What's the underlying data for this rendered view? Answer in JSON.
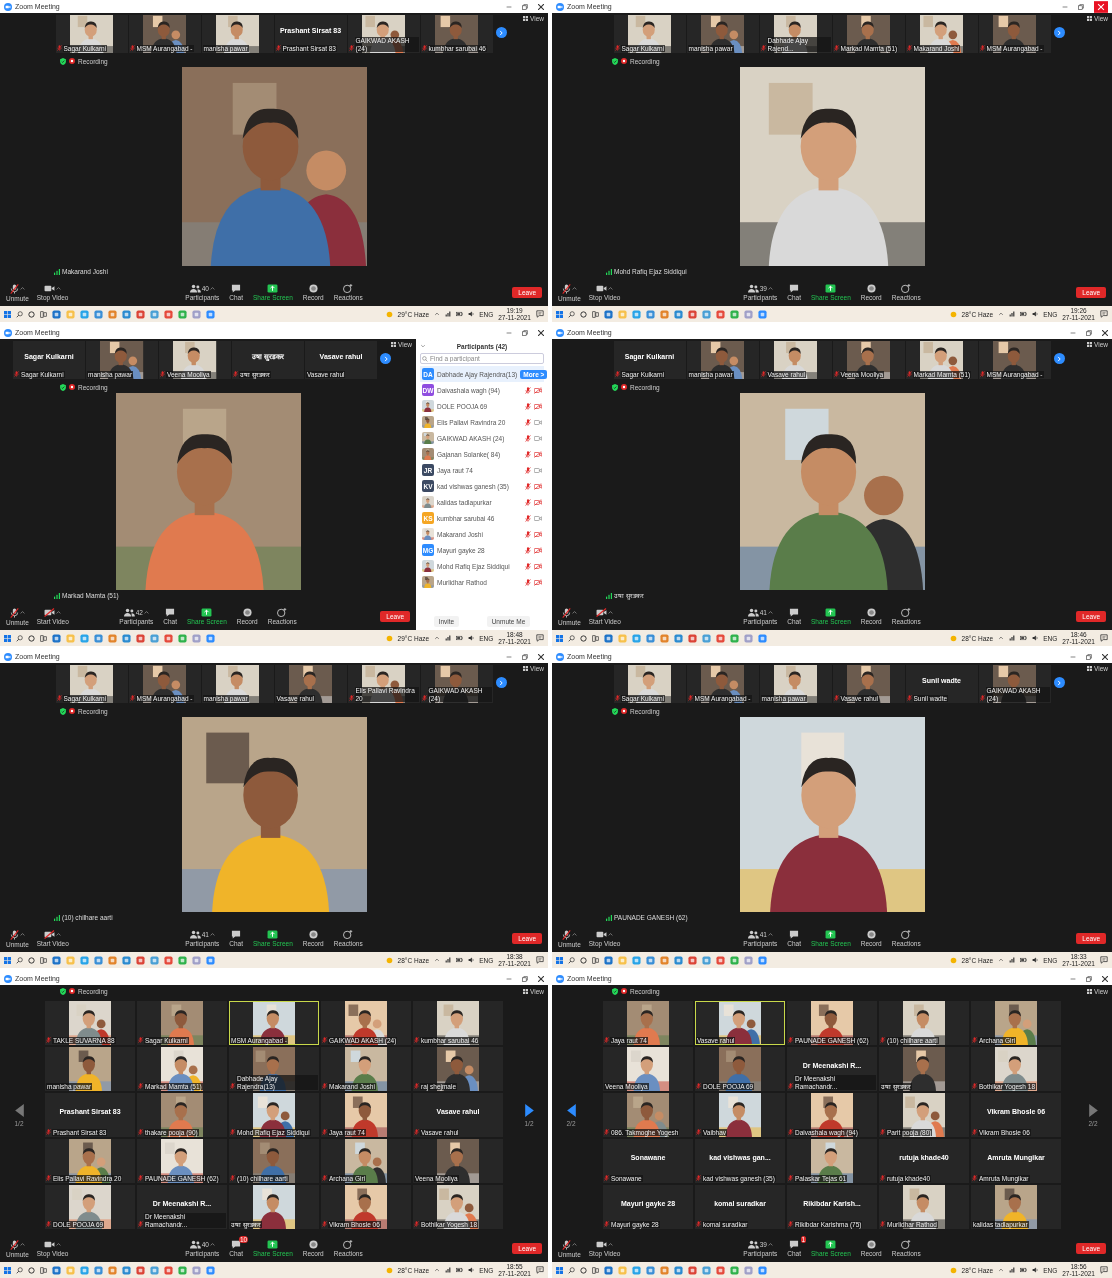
{
  "screens": [
    {
      "title": "Zoom Meeting",
      "close_highlighted": false,
      "view": "View",
      "recording": "Recording",
      "strip": [
        {
          "kind": "video",
          "name": "Sagar Kulkarni",
          "muted": true
        },
        {
          "kind": "video",
          "name": "MSM Aurangabad -",
          "muted": true
        },
        {
          "kind": "video",
          "name": "manisha pawar",
          "muted": false
        },
        {
          "kind": "name",
          "title": "Prashant Sirsat 83",
          "name": "Prashant Sirsat 83",
          "muted": true
        },
        {
          "kind": "video",
          "name": "GAIKWAD AKASH (24)",
          "muted": true
        },
        {
          "kind": "video",
          "name": "kumbhar sarubai 46",
          "muted": true
        }
      ],
      "speaker": {
        "name": "Makarand Joshi"
      },
      "toolbar": {
        "audio": "Unmute",
        "video": {
          "label": "Stop Video",
          "on": true
        },
        "participants": {
          "label": "Participants",
          "count": "40"
        },
        "chat": {
          "label": "Chat"
        },
        "share": "Share Screen",
        "record": "Record",
        "reactions": "Reactions",
        "leave": "Leave"
      },
      "taskbar": {
        "weather": "29°C Haze",
        "language": "ENG",
        "time": "19:19",
        "date": "27-11-2021"
      }
    },
    {
      "title": "Zoom Meeting",
      "close_highlighted": true,
      "view": "View",
      "recording": "Recording",
      "strip": [
        {
          "kind": "video",
          "name": "Sagar Kulkarni",
          "muted": true
        },
        {
          "kind": "video",
          "name": "manisha pawar",
          "muted": false
        },
        {
          "kind": "video",
          "name": "Dabhade Ajay Rajend...",
          "muted": true
        },
        {
          "kind": "video",
          "name": "Markad Mamta (51)",
          "muted": true
        },
        {
          "kind": "video",
          "name": "Makarand Joshi",
          "muted": true
        },
        {
          "kind": "video",
          "name": "MSM Aurangabad -",
          "muted": true
        }
      ],
      "speaker": {
        "name": "Mohd Rafiq Ejaz Siddiqui"
      },
      "toolbar": {
        "audio": "Unmute",
        "video": {
          "label": "Stop Video",
          "on": true
        },
        "participants": {
          "label": "Participants",
          "count": "39"
        },
        "chat": {
          "label": "Chat"
        },
        "share": "Share Screen",
        "record": "Record",
        "reactions": "Reactions",
        "leave": "Leave"
      },
      "taskbar": {
        "weather": "28°C Haze",
        "language": "ENG",
        "time": "19:26",
        "date": "27-11-2021"
      }
    },
    {
      "title": "Zoom Meeting",
      "close_highlighted": false,
      "view": "View",
      "recording": "Recording",
      "strip": [
        {
          "kind": "name",
          "title": "Sagar Kulkarni",
          "name": "Sagar Kulkarni",
          "muted": true
        },
        {
          "kind": "video",
          "name": "manisha pawar",
          "muted": false
        },
        {
          "kind": "video",
          "name": "Veena Mooliya",
          "muted": true
        },
        {
          "kind": "name",
          "title": "उषा सुरडकर",
          "name": "उषा सुरडकर",
          "muted": true
        },
        {
          "kind": "name",
          "title": "Vasave rahul",
          "name": "Vasave rahul",
          "muted": false
        }
      ],
      "speaker": {
        "name": "Markad Mamta (51)"
      },
      "participants_panel": {
        "title": "Participants (42)",
        "placeholder": "Find a participant",
        "items": [
          {
            "name": "Dabhade Ajay Rajendra(13)",
            "avatar": {
              "kind": "initials",
              "text": "DA",
              "color": "#2d8cff"
            },
            "selected": true,
            "action": "More >"
          },
          {
            "name": "Daivashala wagh (94)",
            "avatar": {
              "kind": "initials",
              "text": "DW",
              "color": "#8f4de0"
            },
            "selected": false,
            "muted": true,
            "video_on": false
          },
          {
            "name": "DOLE POOJA 69",
            "selected": false,
            "muted": true,
            "video_on": false
          },
          {
            "name": "Elis Pallavi Ravindra 20",
            "selected": false,
            "muted": true,
            "video_on": true
          },
          {
            "name": "GAIKWAD AKASH (24)",
            "selected": false,
            "muted": true,
            "video_on": true
          },
          {
            "name": "Gajanan Solanke( 84)",
            "selected": false,
            "muted": true,
            "video_on": false
          },
          {
            "name": "Jaya raut 74",
            "avatar": {
              "kind": "initials",
              "text": "JR",
              "color": "#3c4a63"
            },
            "selected": false,
            "muted": true,
            "video_on": true
          },
          {
            "name": "kad vishwas ganesh (35)",
            "avatar": {
              "kind": "initials",
              "text": "KV",
              "color": "#3c4a63"
            },
            "selected": false,
            "muted": true,
            "video_on": false
          },
          {
            "name": "kalidas tadlapurkar",
            "selected": false,
            "muted": true,
            "video_on": false
          },
          {
            "name": "kumbhar sarubai 46",
            "avatar": {
              "kind": "initials",
              "text": "KS",
              "color": "#f5a623"
            },
            "selected": false,
            "muted": true,
            "video_on": true
          },
          {
            "name": "Makarand Joshi",
            "selected": false,
            "muted": true,
            "video_on": false
          },
          {
            "name": "Mayuri gayke 28",
            "avatar": {
              "kind": "initials",
              "text": "MG",
              "color": "#2d8cff"
            },
            "selected": false,
            "muted": true,
            "video_on": false
          },
          {
            "name": "Mohd Rafiq Ejaz Siddiqui",
            "selected": false,
            "muted": true,
            "video_on": false
          },
          {
            "name": "Murlidhar Rathod",
            "selected": false,
            "muted": true,
            "video_on": false
          }
        ],
        "buttons": [
          "Invite",
          "Unmute Me"
        ]
      },
      "toolbar": {
        "audio": "Unmute",
        "video": {
          "label": "Start Video",
          "on": false
        },
        "participants": {
          "label": "Participants",
          "count": "42"
        },
        "chat": {
          "label": "Chat"
        },
        "share": "Share Screen",
        "record": "Record",
        "reactions": "Reactions",
        "leave": "Leave"
      },
      "taskbar": {
        "weather": "29°C Haze",
        "language": "ENG",
        "time": "18:48",
        "date": "27-11-2021"
      }
    },
    {
      "title": "Zoom Meeting",
      "close_highlighted": false,
      "view": "View",
      "recording": "Recording",
      "strip": [
        {
          "kind": "name",
          "title": "Sagar Kulkarni",
          "name": "Sagar Kulkarni",
          "muted": true
        },
        {
          "kind": "video",
          "name": "manisha pawar",
          "muted": false
        },
        {
          "kind": "video",
          "name": "Vasave rahul",
          "muted": true
        },
        {
          "kind": "video",
          "name": "Veena Mooliya",
          "muted": true
        },
        {
          "kind": "video",
          "name": "Markad Mamta (51)",
          "muted": true
        },
        {
          "kind": "video",
          "name": "MSM Aurangabad -",
          "muted": true
        }
      ],
      "speaker": {
        "name": "उषा सुरडकर"
      },
      "toolbar": {
        "audio": "Unmute",
        "video": {
          "label": "Start Video",
          "on": false
        },
        "participants": {
          "label": "Participants",
          "count": "41"
        },
        "chat": {
          "label": "Chat"
        },
        "share": "Share Screen",
        "record": "Record",
        "reactions": "Reactions",
        "leave": "Leave"
      },
      "taskbar": {
        "weather": "28°C Haze",
        "language": "ENG",
        "time": "18:46",
        "date": "27-11-2021"
      }
    },
    {
      "title": "Zoom Meeting",
      "close_highlighted": false,
      "view": "View",
      "recording": "Recording",
      "strip": [
        {
          "kind": "video",
          "name": "Sagar Kulkarni",
          "muted": true
        },
        {
          "kind": "video",
          "name": "MSM Aurangabad -",
          "muted": true
        },
        {
          "kind": "video",
          "name": "manisha pawar",
          "muted": false
        },
        {
          "kind": "video",
          "name": "Vasave rahul",
          "muted": false
        },
        {
          "kind": "video",
          "name": "Elis Pallavi Ravindra 20",
          "muted": true
        },
        {
          "kind": "video",
          "name": "GAIKWAD AKASH (24)",
          "muted": true
        }
      ],
      "speaker": {
        "name": "(10) chilhare aarti"
      },
      "toolbar": {
        "audio": "Unmute",
        "video": {
          "label": "Start Video",
          "on": false
        },
        "participants": {
          "label": "Participants",
          "count": "41"
        },
        "chat": {
          "label": "Chat"
        },
        "share": "Share Screen",
        "record": "Record",
        "reactions": "Reactions",
        "leave": "Leave"
      },
      "taskbar": {
        "weather": "28°C Haze",
        "language": "ENG",
        "time": "18:38",
        "date": "27-11-2021"
      }
    },
    {
      "title": "Zoom Meeting",
      "close_highlighted": false,
      "view": "View",
      "recording": "Recording",
      "strip": [
        {
          "kind": "video",
          "name": "Sagar Kulkarni",
          "muted": true
        },
        {
          "kind": "video",
          "name": "MSM Aurangabad -",
          "muted": true
        },
        {
          "kind": "video",
          "name": "manisha pawar",
          "muted": false
        },
        {
          "kind": "video",
          "name": "Vasave rahul",
          "muted": true
        },
        {
          "kind": "name",
          "title": "Sunil wadte",
          "name": "Sunil wadte",
          "muted": true
        },
        {
          "kind": "video",
          "name": "GAIKWAD AKASH (24)",
          "muted": true
        }
      ],
      "speaker": {
        "name": "PAUNADE GANESH (62)"
      },
      "toolbar": {
        "audio": "Unmute",
        "video": {
          "label": "Stop Video",
          "on": true
        },
        "participants": {
          "label": "Participants",
          "count": "41"
        },
        "chat": {
          "label": "Chat"
        },
        "share": "Share Screen",
        "record": "Record",
        "reactions": "Reactions",
        "leave": "Leave"
      },
      "taskbar": {
        "weather": "28°C Haze",
        "language": "ENG",
        "time": "18:33",
        "date": "27-11-2021"
      }
    },
    {
      "title": "Zoom Meeting",
      "close_highlighted": false,
      "view": "View",
      "recording": "Recording",
      "pager": {
        "left": {
          "enabled": false,
          "page": "1/2"
        },
        "right": {
          "enabled": true,
          "page": "1/2"
        }
      },
      "tiles": [
        {
          "kind": "video",
          "name": "TAKLE SUVARNA 88",
          "muted": true,
          "speaking": false
        },
        {
          "kind": "video",
          "name": "Sagar Kulkarni",
          "muted": true,
          "speaking": false
        },
        {
          "kind": "video",
          "name": "MSM Aurangabad -",
          "muted": false,
          "speaking": true
        },
        {
          "kind": "video",
          "name": "GAIKWAD AKASH (24)",
          "muted": true,
          "speaking": false
        },
        {
          "kind": "video",
          "name": "kumbhar sarubai 46",
          "muted": true,
          "speaking": false
        },
        {
          "kind": "video",
          "name": "manisha pawar",
          "muted": false,
          "speaking": false
        },
        {
          "kind": "video",
          "name": "Markad Mamta (51)",
          "muted": true,
          "speaking": false
        },
        {
          "kind": "video",
          "name": "Dabhade Ajay Rajendra(13)",
          "muted": true,
          "speaking": false
        },
        {
          "kind": "video",
          "name": "Makarand Joshi",
          "muted": true,
          "speaking": false
        },
        {
          "kind": "video",
          "name": "raj shejmale",
          "muted": true,
          "speaking": false
        },
        {
          "kind": "name",
          "title": "Prashant Sirsat 83",
          "name": "Prashant Sirsat 83",
          "muted": true,
          "speaking": false
        },
        {
          "kind": "video",
          "name": "thakare pooja (90)",
          "muted": true,
          "speaking": false
        },
        {
          "kind": "video",
          "name": "Mohd Rafiq Ejaz Siddiqui",
          "muted": true,
          "speaking": false
        },
        {
          "kind": "video",
          "name": "Jaya raut 74",
          "muted": true,
          "speaking": false
        },
        {
          "kind": "name",
          "title": "Vasave rahul",
          "name": "Vasave rahul",
          "muted": true,
          "speaking": false
        },
        {
          "kind": "video",
          "name": "Elis Pallavi Ravindra 20",
          "muted": true,
          "speaking": false
        },
        {
          "kind": "video",
          "name": "PAUNADE GANESH (62)",
          "muted": true,
          "speaking": false
        },
        {
          "kind": "video",
          "name": "(10) chilhare aarti",
          "muted": true,
          "speaking": false
        },
        {
          "kind": "video",
          "name": "Archana Giri",
          "muted": true,
          "speaking": false
        },
        {
          "kind": "video",
          "name": "Veena Mooliya",
          "muted": false,
          "speaking": false
        },
        {
          "kind": "video",
          "name": "DOLE POOJA 69",
          "muted": true,
          "speaking": false
        },
        {
          "kind": "name",
          "title": "Dr Meenakshi R...",
          "name": "Dr Meenakshi Ramachandr...",
          "muted": true,
          "speaking": false
        },
        {
          "kind": "video",
          "name": "उषा सुरडकर",
          "muted": false,
          "speaking": false
        },
        {
          "kind": "video",
          "name": "Vikram Bhosle 06",
          "muted": true,
          "speaking": false
        },
        {
          "kind": "video",
          "name": "Bothikar Yogesh 18",
          "muted": true,
          "speaking": false
        }
      ],
      "toolbar": {
        "audio": "Unmute",
        "video": {
          "label": "Stop Video",
          "on": true
        },
        "participants": {
          "label": "Participants",
          "count": "40"
        },
        "chat": {
          "label": "Chat",
          "badge": "10"
        },
        "share": "Share Screen",
        "record": "Record",
        "reactions": "Reactions",
        "leave": "Leave"
      },
      "taskbar": {
        "weather": "28°C Haze",
        "language": "ENG",
        "time": "18:55",
        "date": "27-11-2021"
      }
    },
    {
      "title": "Zoom Meeting",
      "close_highlighted": false,
      "view": "View",
      "recording": "Recording",
      "pager": {
        "left": {
          "enabled": true,
          "page": "2/2"
        },
        "right": {
          "enabled": false,
          "page": "2/2"
        }
      },
      "tiles": [
        {
          "kind": "video",
          "name": "Jaya raut 74",
          "muted": true,
          "speaking": false
        },
        {
          "kind": "video",
          "name": "Vasave rahul",
          "muted": false,
          "speaking": true
        },
        {
          "kind": "video",
          "name": "PAUNADE GANESH (62)",
          "muted": true,
          "speaking": false
        },
        {
          "kind": "video",
          "name": "(10) chilhare aarti",
          "muted": true,
          "speaking": false
        },
        {
          "kind": "video",
          "name": "Archana Giri",
          "muted": true,
          "speaking": false
        },
        {
          "kind": "video",
          "name": "Veena Mooliya",
          "muted": false,
          "speaking": false
        },
        {
          "kind": "video",
          "name": "DOLE POOJA 69",
          "muted": true,
          "speaking": false
        },
        {
          "kind": "name",
          "title": "Dr Meenakshi R...",
          "name": "Dr Meenakshi Ramachandr...",
          "muted": true,
          "speaking": false
        },
        {
          "kind": "video",
          "name": "उषा सुरडकर",
          "muted": false,
          "speaking": false
        },
        {
          "kind": "video",
          "name": "Bothikar Yogesh 18",
          "muted": true,
          "speaking": false
        },
        {
          "kind": "video",
          "name": "086. Takmoghe Yogesh",
          "muted": true,
          "speaking": false
        },
        {
          "kind": "video",
          "name": "Vaibhav",
          "muted": true,
          "speaking": false
        },
        {
          "kind": "video",
          "name": "Daivashala wagh (94)",
          "muted": true,
          "speaking": false
        },
        {
          "kind": "video",
          "name": "Parit pooja (80)",
          "muted": true,
          "speaking": false
        },
        {
          "kind": "name",
          "title": "Vikram Bhosle 06",
          "name": "Vikram Bhosle 06",
          "muted": true,
          "speaking": false
        },
        {
          "kind": "name",
          "title": "Sonawane",
          "name": "Sonawane",
          "muted": true,
          "speaking": false
        },
        {
          "kind": "name",
          "title": "kad vishwas gan...",
          "name": "kad vishwas ganesh (35)",
          "muted": true,
          "speaking": false
        },
        {
          "kind": "video",
          "name": "Palaskar Tejas 61",
          "muted": true,
          "speaking": false
        },
        {
          "kind": "name",
          "title": "rutuja khade40",
          "name": "rutuja khade40",
          "muted": true,
          "speaking": false
        },
        {
          "kind": "name",
          "title": "Amruta Mungikar",
          "name": "Amruta Mungikar",
          "muted": true,
          "speaking": false
        },
        {
          "kind": "name",
          "title": "Mayuri gayke 28",
          "name": "Mayuri gayke 28",
          "muted": true,
          "speaking": false
        },
        {
          "kind": "name",
          "title": "komal suradkar",
          "name": "komal suradkar",
          "muted": true,
          "speaking": false
        },
        {
          "kind": "name",
          "title": "Rikibdar Karish...",
          "name": "Rikibdar Karishma (75)",
          "muted": true,
          "speaking": false
        },
        {
          "kind": "video",
          "name": "Murlidhar Rathod",
          "muted": true,
          "speaking": false
        },
        {
          "kind": "video",
          "name": "kalidas tadlapurkar",
          "muted": false,
          "speaking": false
        }
      ],
      "toolbar": {
        "audio": "Unmute",
        "video": {
          "label": "Stop Video",
          "on": true
        },
        "participants": {
          "label": "Participants",
          "count": "39"
        },
        "chat": {
          "label": "Chat",
          "badge": "1"
        },
        "share": "Share Screen",
        "record": "Record",
        "reactions": "Reactions",
        "leave": "Leave"
      },
      "taskbar": {
        "weather": "28°C Haze",
        "language": "ENG",
        "time": "18:56",
        "date": "27-11-2021"
      }
    }
  ]
}
